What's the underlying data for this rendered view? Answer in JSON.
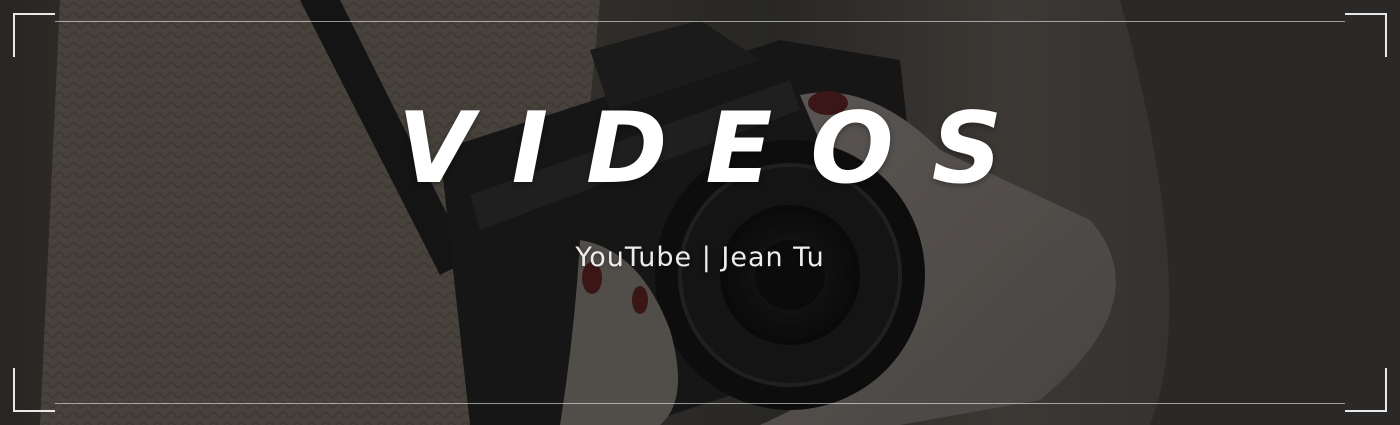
{
  "banner": {
    "title": "VIDEOS",
    "subtitle": "YouTube | Jean Tu"
  },
  "colors": {
    "title_text": "#ffffff",
    "subtitle_text": "#ececec",
    "frame": "#e8e8e8"
  },
  "icons": {
    "background": "camera-photo-image"
  }
}
